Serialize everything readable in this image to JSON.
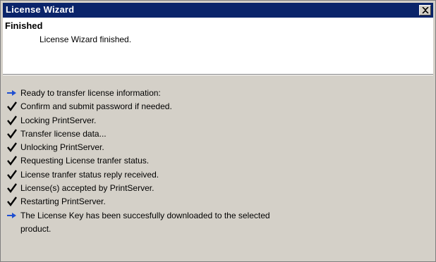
{
  "window": {
    "title": "License Wizard",
    "close_glyph": "✕"
  },
  "header": {
    "title": "Finished",
    "subtitle": "License Wizard finished."
  },
  "log": {
    "items": [
      {
        "icon": "arrow-right-icon",
        "text": "Ready to transfer license information:"
      },
      {
        "icon": "check-icon",
        "text": "Confirm and submit password if needed."
      },
      {
        "icon": "check-icon",
        "text": "Locking PrintServer."
      },
      {
        "icon": "check-icon",
        "text": "Transfer license data..."
      },
      {
        "icon": "check-icon",
        "text": "Unlocking PrintServer."
      },
      {
        "icon": "check-icon",
        "text": "Requesting License tranfer status."
      },
      {
        "icon": "check-icon",
        "text": "License tranfer status reply received."
      },
      {
        "icon": "check-icon",
        "text": "License(s) accepted by PrintServer."
      },
      {
        "icon": "check-icon",
        "text": "Restarting PrintServer."
      },
      {
        "icon": "arrow-right-icon",
        "text": "The License Key has been succesfully downloaded to the selected",
        "text2": "product."
      }
    ]
  },
  "colors": {
    "titlebar": "#0a246a",
    "window_bg": "#d4d0c8",
    "arrow": "#1f4fd1"
  }
}
